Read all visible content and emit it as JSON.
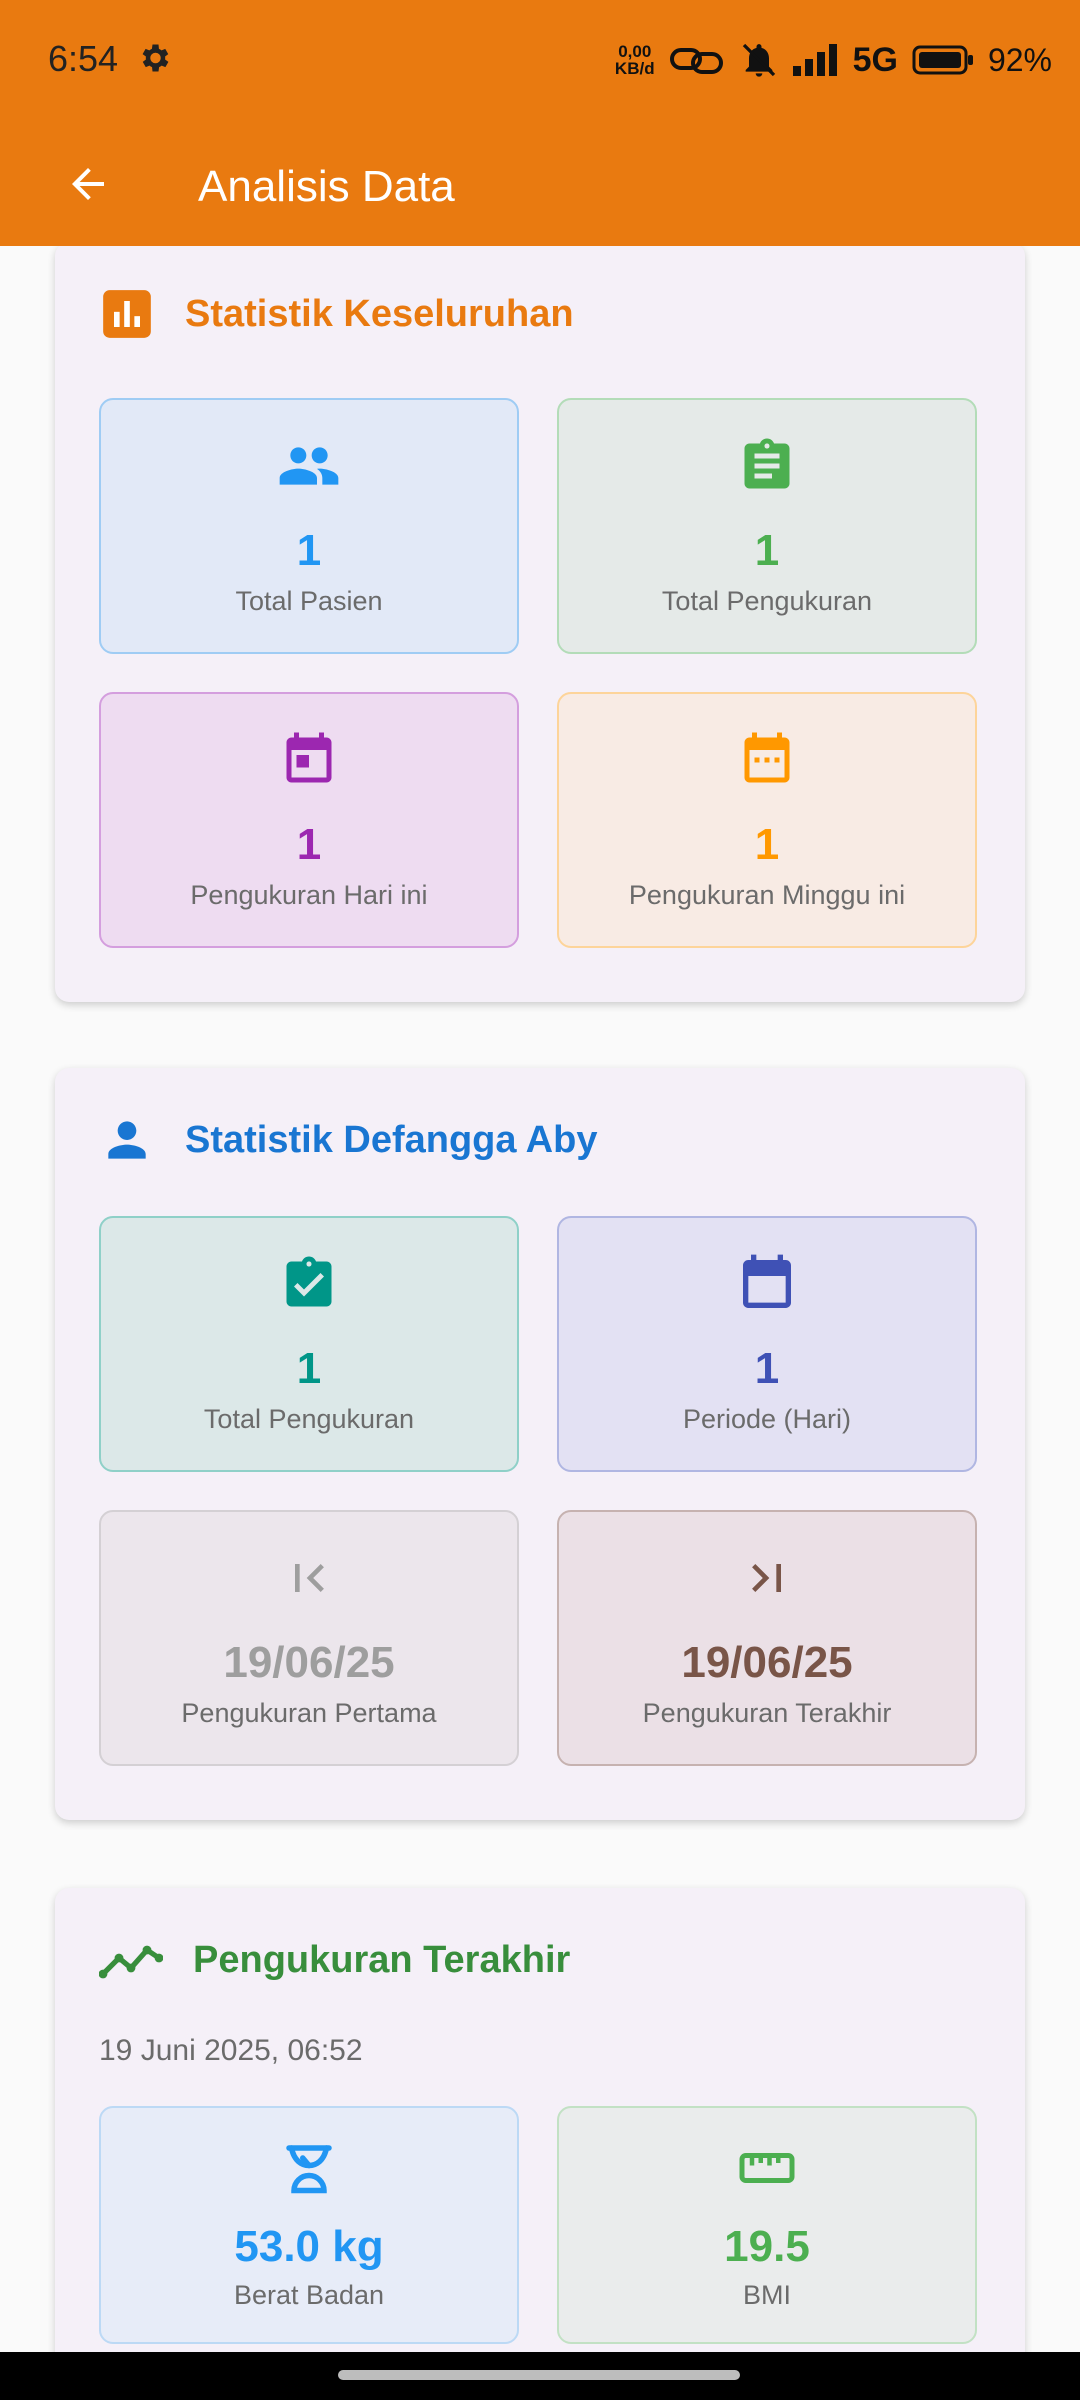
{
  "status_bar": {
    "time": "6:54",
    "net_speed_top": "0,00",
    "net_speed_bottom": "KB/d",
    "network_type": "5G",
    "battery": "92%",
    "icons": [
      "gear-icon",
      "link-icon",
      "mute-icon",
      "signal-icon",
      "battery-icon"
    ]
  },
  "app_bar": {
    "title": "Analisis Data",
    "back_icon": "arrow-back-icon"
  },
  "colors": {
    "primary": "#E97A10",
    "blue": "#2196F3",
    "green": "#4CAF50",
    "purple": "#9C27B0",
    "orange": "#FF9800",
    "teal": "#009688",
    "indigo": "#3F51B5",
    "grey": "#9E9E9E",
    "brown": "#795548"
  },
  "overall": {
    "title": "Statistik Keseluruhan",
    "icon": "bar-chart-icon",
    "tiles": [
      {
        "value": "1",
        "label": "Total Pasien",
        "icon": "people-icon"
      },
      {
        "value": "1",
        "label": "Total Pengukuran",
        "icon": "assignment-icon"
      },
      {
        "value": "1",
        "label": "Pengukuran Hari ini",
        "icon": "event-today-icon"
      },
      {
        "value": "1",
        "label": "Pengukuran Minggu ini",
        "icon": "date-range-icon"
      }
    ]
  },
  "patient": {
    "title": "Statistik Defangga Aby",
    "icon": "person-icon",
    "tiles": [
      {
        "value": "1",
        "label": "Total Pengukuran",
        "icon": "assignment-check-icon"
      },
      {
        "value": "1",
        "label": "Periode (Hari)",
        "icon": "calendar-icon"
      },
      {
        "value": "19/06/25",
        "label": "Pengukuran Pertama",
        "icon": "first-page-icon"
      },
      {
        "value": "19/06/25",
        "label": "Pengukuran Terakhir",
        "icon": "last-page-icon"
      }
    ]
  },
  "latest": {
    "title": "Pengukuran Terakhir",
    "icon": "trending-up-icon",
    "datetime": "19 Juni 2025, 06:52",
    "tiles": [
      {
        "value": "53.0 kg",
        "label": "Berat Badan",
        "icon": "scale-icon"
      },
      {
        "value": "19.5",
        "label": "BMI",
        "icon": "ruler-icon"
      }
    ]
  }
}
